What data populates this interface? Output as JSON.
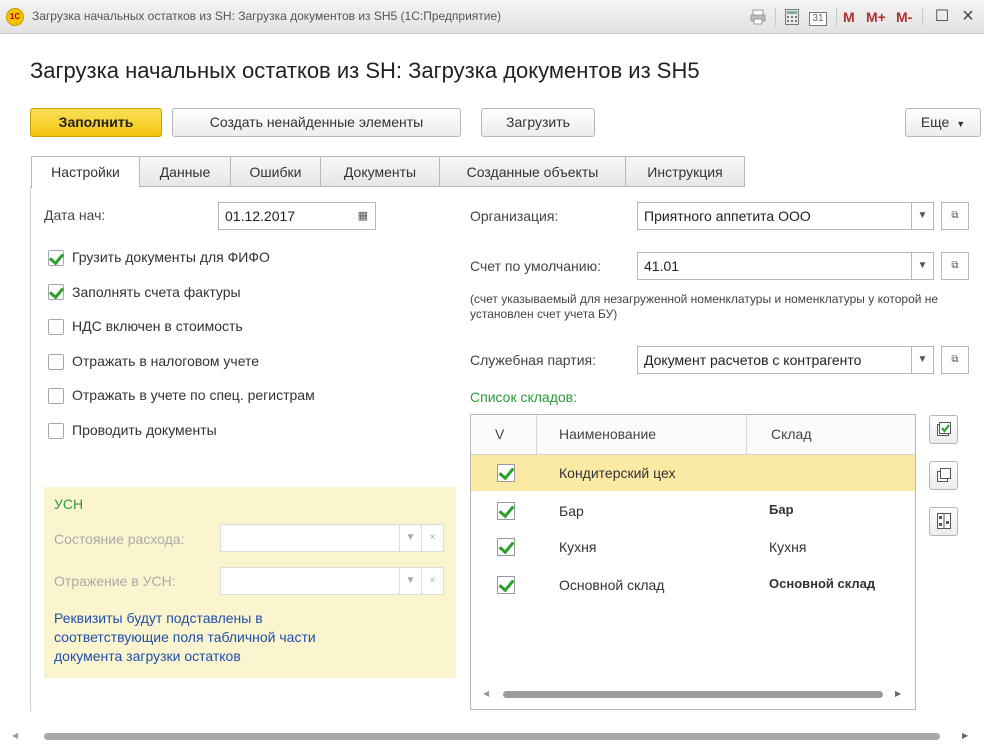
{
  "window": {
    "title": "Загрузка начальных остатков из SH: Загрузка документов из SH5  (1С:Предприятие)",
    "logo": "1С",
    "controls": {
      "print_icon": "printer-icon",
      "calc_icon": "calculator-icon",
      "calendar_icon": "calendar-icon",
      "calendar_label": "31",
      "m": "M",
      "m_plus": "M+",
      "m_minus": "M-",
      "maximize": "☐",
      "close": "×"
    }
  },
  "page_title": "Загрузка начальных остатков из SH: Загрузка документов из SH5",
  "toolbar": {
    "fill_label": "Заполнить",
    "create_label": "Создать ненайденные элементы",
    "load_label": "Загрузить",
    "more_label": "Еще"
  },
  "tabs": [
    {
      "label": "Настройки",
      "active": true
    },
    {
      "label": "Данные",
      "active": false
    },
    {
      "label": "Ошибки",
      "active": false
    },
    {
      "label": "Документы",
      "active": false
    },
    {
      "label": "Созданные объекты",
      "active": false
    },
    {
      "label": "Инструкция",
      "active": false
    }
  ],
  "settings": {
    "date_label": "Дата нач:",
    "date_value": "01.12.2017",
    "checkboxes": [
      {
        "label": "Грузить документы для ФИФО",
        "checked": true
      },
      {
        "label": "Заполнять счета фактуры",
        "checked": true
      },
      {
        "label": "НДС включен в стоимость",
        "checked": false
      },
      {
        "label": "Отражать в налоговом учете",
        "checked": false
      },
      {
        "label": "Отражать в учете по спец. регистрам",
        "checked": false
      },
      {
        "label": "Проводить документы",
        "checked": false
      }
    ],
    "organization_label": "Организация:",
    "organization_value": "Приятного аппетита ООО",
    "account_label": "Счет по умолчанию:",
    "account_value": "41.01",
    "account_note": "(счет указываемый для незагруженной номенклатуры и  номенклатуры у которой не установлен счет учета БУ)",
    "party_label": "Служебная партия:",
    "party_value": "Документ расчетов с контрагенто"
  },
  "usn": {
    "title": "УСН",
    "expense_label": "Состояние расхода:",
    "reflect_label": "Отражение в УСН:",
    "note": "Реквизиты будут подставлены в соответствующие поля табличной части документа загрузки остатков"
  },
  "warehouses": {
    "title": "Список складов:",
    "columns": [
      "V",
      "Наименование",
      "Склад"
    ],
    "rows": [
      {
        "checked": true,
        "name": "Кондитерский цех",
        "warehouse": "",
        "selected": true
      },
      {
        "checked": true,
        "name": "Бар",
        "warehouse": "Бар",
        "selected": false
      },
      {
        "checked": true,
        "name": "Кухня",
        "warehouse": "Кухня",
        "selected": false
      },
      {
        "checked": true,
        "name": "Основной склад",
        "warehouse": "Основной склад",
        "selected": false
      }
    ],
    "side_buttons": [
      "check-all-icon",
      "copy-icon",
      "table-settings-icon"
    ]
  },
  "colors": {
    "primary_button": "#f2c40c",
    "usn_panel": "#fbf5cf",
    "usn_text": "#2a9a3a",
    "usn_note": "#1f4fa8",
    "list_title": "#2a9a3a",
    "selected_row": "#faeaa4",
    "checkmark": "#2e9e2e"
  }
}
